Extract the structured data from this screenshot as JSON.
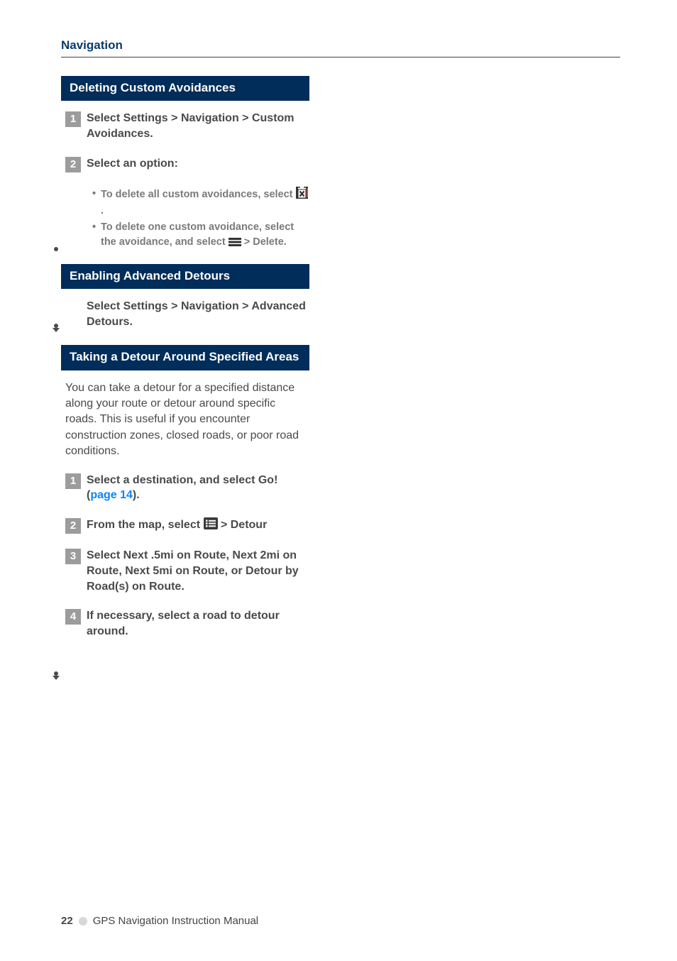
{
  "header": {
    "section": "Navigation"
  },
  "sections": {
    "s1": {
      "heading": "Deleting Custom Avoidances",
      "step1": "Select Settings > Navigation > Custom Avoidances.",
      "step2": "Select an option:",
      "bullet1a": "To delete all custom avoidances, select ",
      "bullet1b": ".",
      "bullet2a": "To delete one custom avoidance, select the avoidance, and select ",
      "bullet2b": " > Delete."
    },
    "s2": {
      "heading": "Enabling Advanced Detours",
      "step1": "Select Settings > Navigation > Advanced Detours."
    },
    "s3": {
      "heading": "Taking a Detour Around Specified Areas",
      "intro": "You can take a detour for a specified distance along your route or detour around specific roads. This is useful if you encounter construction zones, closed roads, or poor road conditions.",
      "step1a": "Select a destination, and select Go! (",
      "step1link": "page 14",
      "step1b": ").",
      "step2a": "From the map, select ",
      "step2b": " > Detour",
      "step3": "Select Next .5mi on Route, Next 2mi on Route, Next 5mi on Route, or Detour by Road(s) on Route.",
      "step4": "If necessary, select a road to detour around."
    }
  },
  "icons": {
    "trash": "trash-x-icon",
    "menu_lines": "menu-lines-icon",
    "list": "list-box-icon"
  },
  "footer": {
    "page": "22",
    "title": "GPS Navigation Instruction Manual"
  },
  "step_numbers": {
    "n1": "1",
    "n2": "2",
    "n3": "3",
    "n4": "4"
  }
}
